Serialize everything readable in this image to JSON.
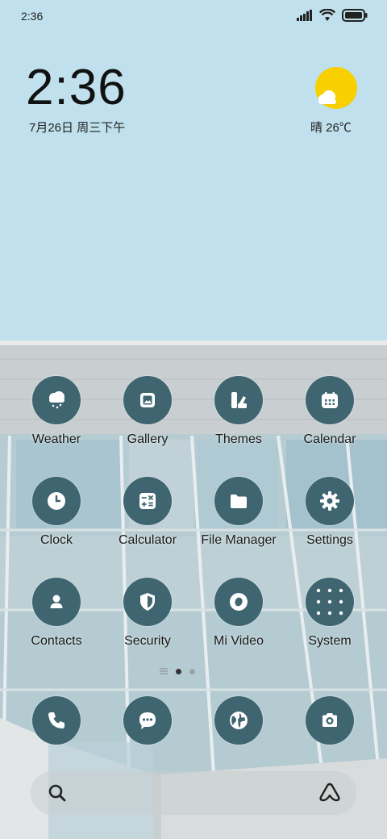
{
  "status_bar": {
    "time": "2:36",
    "icons": [
      "cellular-signal-icon",
      "wifi-icon",
      "battery-icon"
    ]
  },
  "clock_widget": {
    "time": "2:36",
    "date": "7月26日 周三下午"
  },
  "weather_widget": {
    "icon": "sun-cloud-icon",
    "text": "晴 26℃"
  },
  "apps": [
    {
      "label": "Weather",
      "icon": "weather-icon"
    },
    {
      "label": "Gallery",
      "icon": "gallery-icon"
    },
    {
      "label": "Themes",
      "icon": "themes-icon"
    },
    {
      "label": "Calendar",
      "icon": "calendar-icon"
    },
    {
      "label": "Clock",
      "icon": "clock-icon"
    },
    {
      "label": "Calculator",
      "icon": "calculator-icon"
    },
    {
      "label": "File Manager",
      "icon": "folder-icon"
    },
    {
      "label": "Settings",
      "icon": "gear-icon"
    },
    {
      "label": "Contacts",
      "icon": "person-icon"
    },
    {
      "label": "Security",
      "icon": "shield-icon"
    },
    {
      "label": "Mi Video",
      "icon": "video-icon"
    },
    {
      "label": "System",
      "icon": "system-folder-icon"
    }
  ],
  "page_indicator": {
    "pages": 2,
    "active": 1
  },
  "dock": [
    {
      "icon": "phone-icon"
    },
    {
      "icon": "messages-icon"
    },
    {
      "icon": "browser-icon"
    },
    {
      "icon": "camera-icon"
    }
  ],
  "search_bar": {
    "icons": [
      "search-icon",
      "assistant-icon"
    ]
  },
  "colors": {
    "sky": "#bfe0ec",
    "icon_bg": "#3e6570",
    "sun": "#f8d000"
  }
}
